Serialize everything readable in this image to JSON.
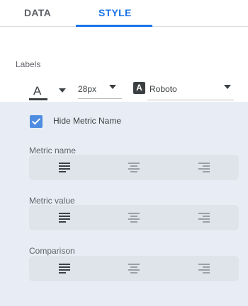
{
  "tabs": [
    {
      "label": "DATA",
      "active": false
    },
    {
      "label": "STYLE",
      "active": true
    }
  ],
  "labels": {
    "title": "Labels",
    "font_color": {
      "glyph": "A",
      "color": "#3c4043"
    },
    "font_size": "28px",
    "font_family": {
      "icon_letter": "A",
      "value": "Roboto"
    }
  },
  "hide_metric_name": {
    "label": "Hide Metric Name",
    "checked": true
  },
  "alignment_groups": [
    {
      "label": "Metric name",
      "selected": "left"
    },
    {
      "label": "Metric value",
      "selected": "left"
    },
    {
      "label": "Comparison",
      "selected": "left"
    }
  ],
  "colors": {
    "accent": "#1a73e8",
    "panel_bg": "#e8edf5",
    "checkbox": "#4f8de0"
  }
}
